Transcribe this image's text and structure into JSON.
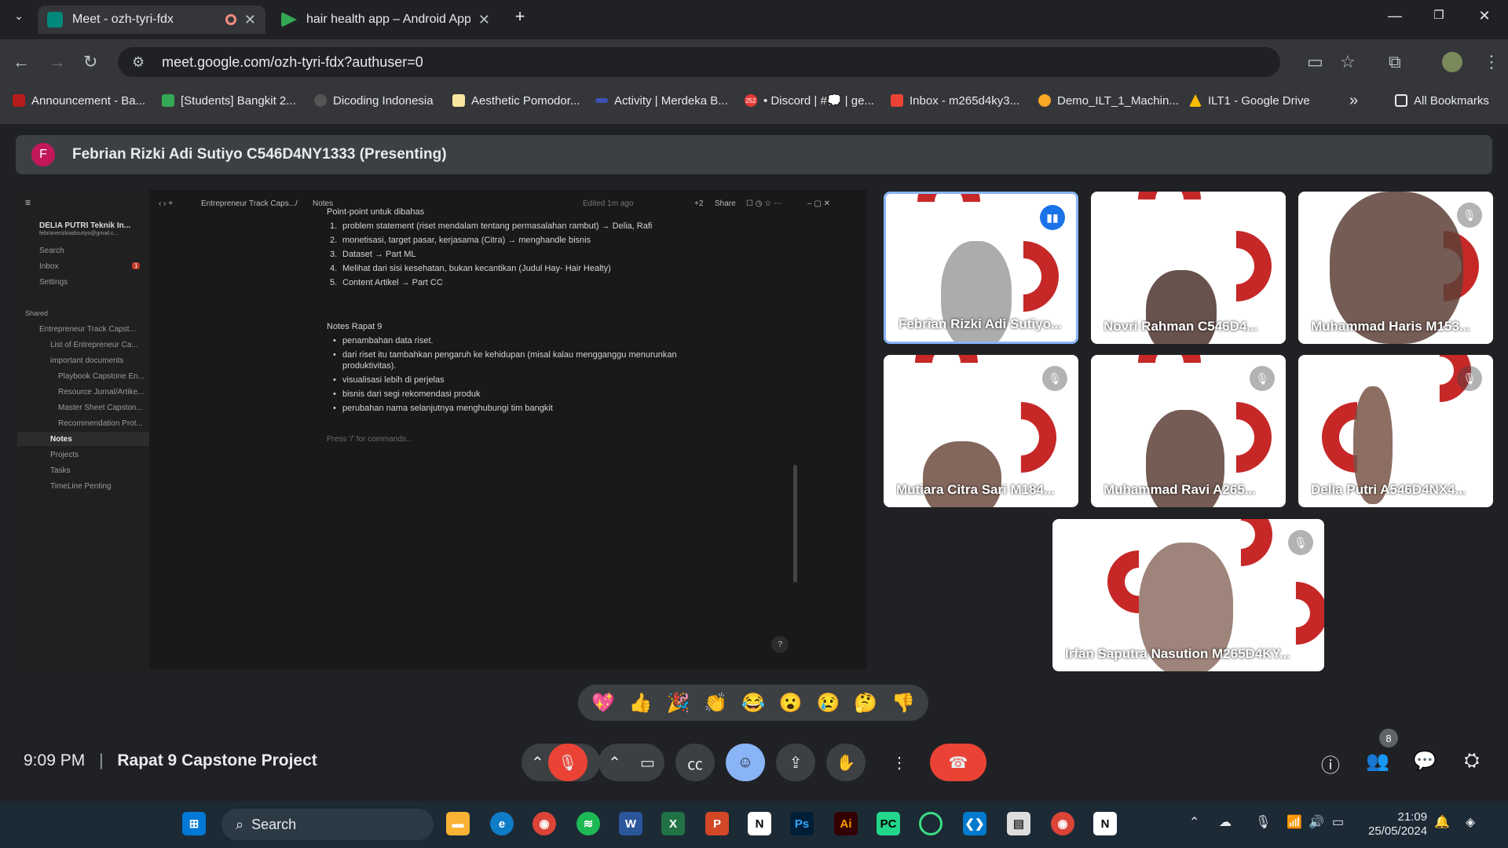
{
  "browser": {
    "tabs": [
      {
        "label": "Meet - ozh-tyri-fdx",
        "icon_color": "#00897b"
      },
      {
        "label": "hair health app – Android Apps",
        "icon_color": "#34a853"
      }
    ],
    "new_tab": "+",
    "url": "meet.google.com/ozh-tyri-fdx?authuser=0",
    "bookmarks": [
      "Announcement - Ba...",
      "[Students] Bangkit 2...",
      "Dicoding Indonesia",
      "Aesthetic Pomodor...",
      "Activity | Merdeka B...",
      "• Discord | #💭 | ge...",
      "Inbox - m265d4ky3...",
      "Demo_ILT_1_Machin...",
      "ILT1 - Google Drive"
    ],
    "discord_badge": "252",
    "more": "»",
    "all_bookmarks": "All Bookmarks"
  },
  "meet": {
    "presenter_initial": "F",
    "presenter_title": "Febrian Rizki Adi Sutiyo C546D4NY1333 (Presenting)",
    "time": "9:09 PM",
    "separator": "|",
    "meeting_name": "Rapat 9 Capstone Project",
    "participant_count": "8",
    "reactions": [
      "💖",
      "👍",
      "🎉",
      "👏",
      "😂",
      "😮",
      "😢",
      "🤔",
      "👎"
    ],
    "participants": [
      {
        "name": "Febrian Rizki Adi Sutiyo...",
        "speaking": true
      },
      {
        "name": "Novri Rahman C546D4...",
        "speaking": false
      },
      {
        "name": "Muhammad Haris M153...",
        "speaking": false
      },
      {
        "name": "Mutiara Citra Sari M184...",
        "speaking": false
      },
      {
        "name": "Muhammad Ravi A265...",
        "speaking": false
      },
      {
        "name": "Delia Putri A546D4NX4...",
        "speaking": false
      },
      {
        "name": "Irfan Saputra Nasution M265D4KY...",
        "speaking": false
      }
    ]
  },
  "notion": {
    "workspace": "DELIA PUTRI Teknik In...",
    "email": "febrianerizkiadisutiyo@gmail.c...",
    "search": "Search",
    "inbox": "Inbox",
    "inbox_count": "1",
    "settings": "Settings",
    "shared": "Shared",
    "tree": [
      "Entrepreneur Track Capst...",
      "List of Entrepreneur Ca...",
      "important documents",
      "Playbook Capstone En...",
      "Resource Jurnal/Artike...",
      "Master Sheet Capston...",
      "Recommendation Prot...",
      "Notes",
      "Projects",
      "Tasks",
      "TimeLine Penting"
    ],
    "crumb1": "Entrepreneur Track Caps...",
    "crumb_sep": "/",
    "crumb2": "Notes",
    "edited": "Edited 1m ago",
    "plus": "+2",
    "share": "Share",
    "h1": "Point-point untuk dibahas",
    "list1": [
      "problem statement (riset mendalam tentang permasalahan rambut) → Delia, Rafi",
      "monetisasi, target pasar, kerjasama (Citra) → menghandle bisnis",
      "Dataset → Part ML",
      "Melihat dari sisi kesehatan, bukan kecantikan (Judul Hay- Hair Healty)",
      "Content Artikel → Part CC"
    ],
    "h2": "Notes Rapat 9",
    "list2": [
      "penambahan data riset.",
      "dari riset itu tambahkan pengaruh ke kehidupan (misal kalau mengganggu menurunkan",
      "produktivitas).",
      "visualisasi lebih di perjelas",
      "bisnis dari segi rekomendasi produk",
      "perubahan nama selanjutnya menghubungi tim bangkit"
    ],
    "placeholder": "Press '/' for commands...",
    "help": "?"
  },
  "taskbar": {
    "search": "Search",
    "time": "21:09",
    "date": "25/05/2024"
  }
}
